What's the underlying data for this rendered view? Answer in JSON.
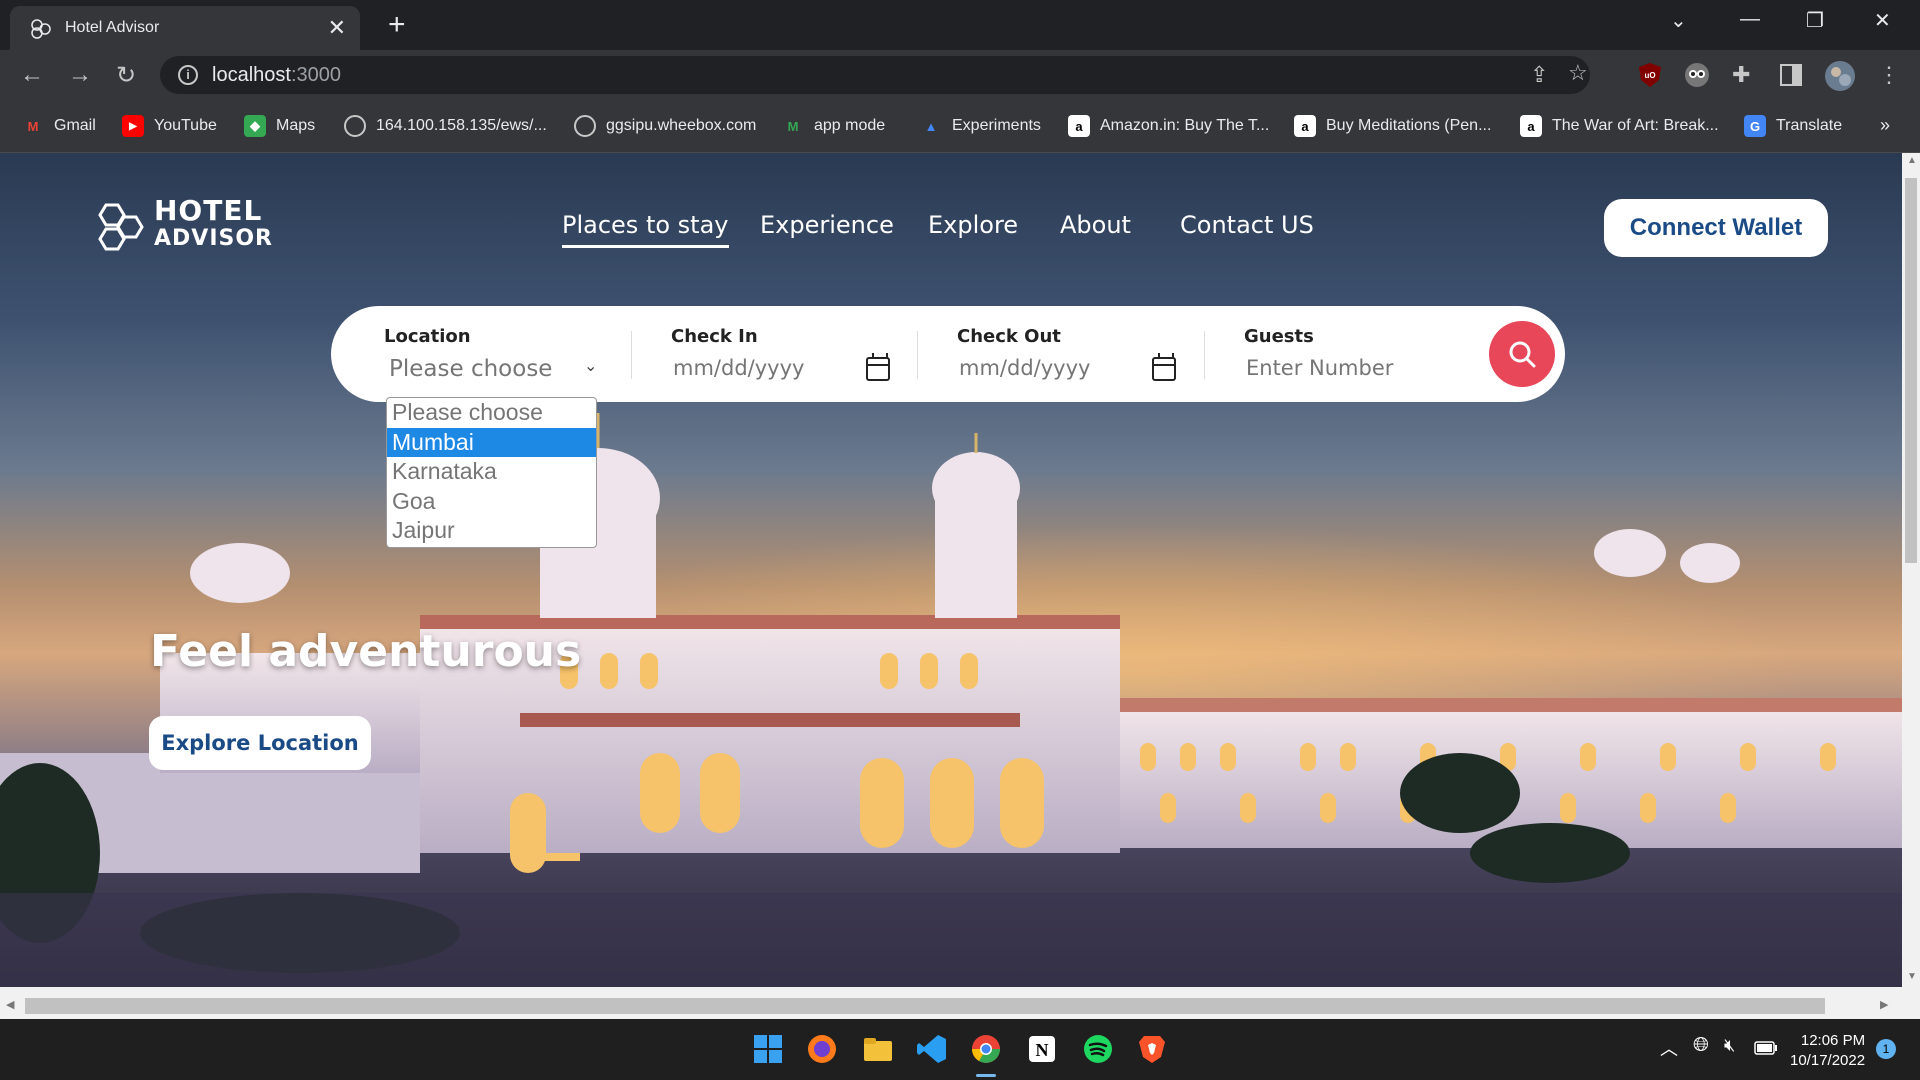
{
  "browser": {
    "tab_title": "Hotel Advisor",
    "tab_close": "✕",
    "new_tab": "+",
    "url_host": "localhost",
    "url_port": ":3000",
    "bookmarks": [
      "Gmail",
      "YouTube",
      "Maps",
      "164.100.158.135/ews/...",
      "ggsipu.wheebox.com",
      "app mode",
      "Experiments",
      "Amazon.in: Buy The T...",
      "Buy Meditations (Pen...",
      "The War of Art: Break...",
      "Translate"
    ],
    "more_bookmarks": "»"
  },
  "site": {
    "logo_line1": "HOTEL",
    "logo_line2": "ADVISOR",
    "nav": [
      "Places to stay",
      "Experience",
      "Explore",
      "About",
      "Contact US"
    ],
    "connect_wallet": "Connect Wallet",
    "search": {
      "location_label": "Location",
      "location_value": "Please choose",
      "checkin_label": "Check In",
      "checkin_placeholder": "mm/dd/yyyy",
      "checkout_label": "Check Out",
      "checkout_placeholder": "mm/dd/yyyy",
      "guests_label": "Guests",
      "guests_placeholder": "Enter Number"
    },
    "dropdown_options": [
      "Please choose",
      "Mumbai",
      "Karnataka",
      "Goa",
      "Jaipur"
    ],
    "headline": "Feel adventurous",
    "explore_button": "Explore Location"
  },
  "taskbar": {
    "time": "12:06 PM",
    "date": "10/17/2022",
    "notification_count": "1"
  },
  "colors": {
    "accent_blue": "#1b4b86",
    "search_red": "#e8475a",
    "selected_option": "#1e88e5"
  }
}
